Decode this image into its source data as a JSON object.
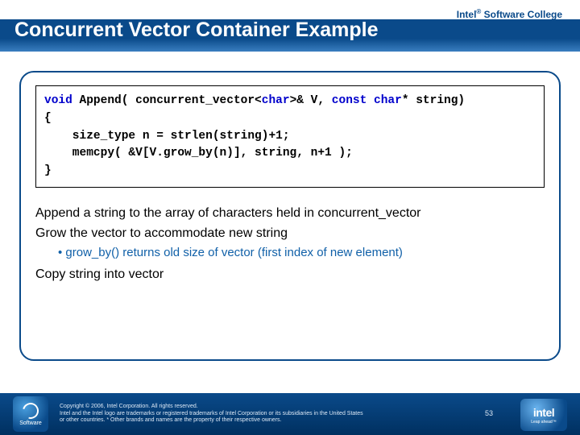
{
  "brand": {
    "prefix": "Intel",
    "reg": "®",
    "suffix": " Software College"
  },
  "title": "Concurrent Vector Container Example",
  "code": {
    "line1a": "void",
    "line1b": " Append( concurrent_vector<",
    "line1c": "char",
    "line1d": ">& V, ",
    "line1e": "const char",
    "line1f": "* string)",
    "line2": "{",
    "line3": "    size_type n = strlen(string)+1;",
    "line4": "    memcpy( &V[V.grow_by(n)], string, n+1 );",
    "line5": "}"
  },
  "desc": {
    "p1": "Append a string to the array of characters held in concurrent_vector",
    "p2": "Grow the vector to accommodate new string",
    "b1": "grow_by() returns old size of vector (first index of new element)",
    "p3": "Copy string into vector"
  },
  "footer": {
    "copyright": "Copyright © 2006, Intel Corporation. All rights reserved.",
    "legal1": "Intel and the Intel logo are trademarks or registered trademarks of Intel Corporation or its subsidiaries in the United States",
    "legal2": "or other countries. * Other brands and names are the property of their respective owners.",
    "page": "53",
    "leftBadge": "Software",
    "rightBadge": "intel",
    "rightTag": "Leap ahead™"
  }
}
